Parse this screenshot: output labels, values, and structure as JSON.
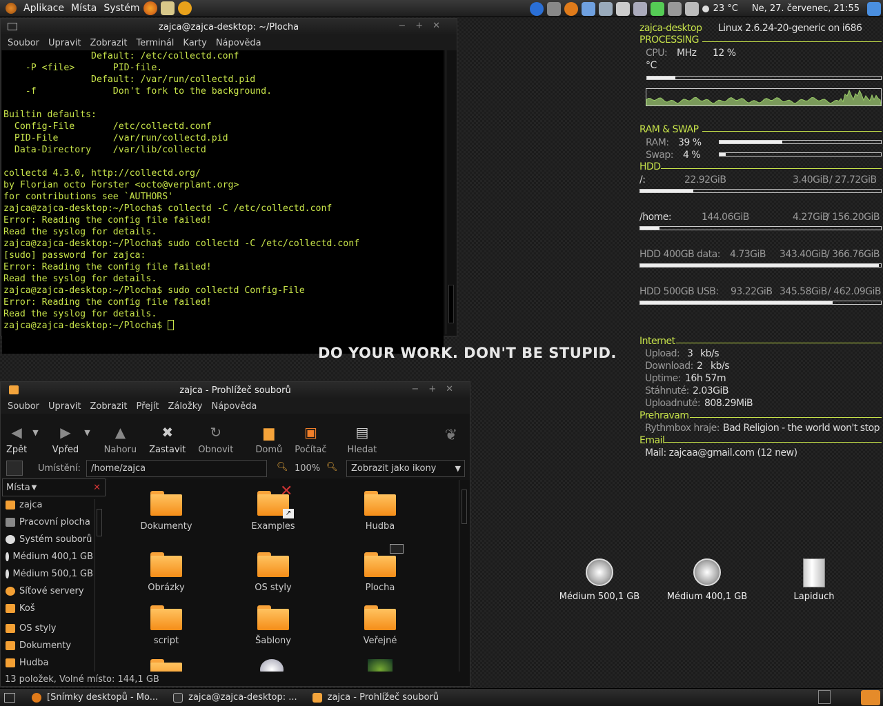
{
  "top_panel": {
    "menu_apps": "Aplikace",
    "menu_places": "Místa",
    "menu_system": "Systém",
    "temp": "23 °C",
    "clock": "Ne, 27. červenec, 21:55"
  },
  "terminal": {
    "title": "zajca@zajca-desktop: ~/Plocha",
    "menu": [
      "Soubor",
      "Upravit",
      "Zobrazit",
      "Terminál",
      "Karty",
      "Nápověda"
    ],
    "lines": [
      "                Default: /etc/collectd.conf",
      "    -P <file>       PID-file.",
      "                Default: /var/run/collectd.pid",
      "    -f              Don't fork to the background.",
      "",
      "Builtin defaults:",
      "  Config-File       /etc/collectd.conf",
      "  PID-File          /var/run/collectd.pid",
      "  Data-Directory    /var/lib/collectd",
      "",
      "collectd 4.3.0, http://collectd.org/",
      "by Florian octo Forster <octo@verplant.org>",
      "for contributions see `AUTHORS'",
      "zajca@zajca-desktop:~/Plocha$ collectd -C /etc/collectd.conf",
      "Error: Reading the config file failed!",
      "Read the syslog for details.",
      "zajca@zajca-desktop:~/Plocha$ sudo collectd -C /etc/collectd.conf",
      "[sudo] password for zajca:",
      "Error: Reading the config file failed!",
      "Read the syslog for details.",
      "zajca@zajca-desktop:~/Plocha$ sudo collectd Config-File",
      "Error: Reading the config file failed!",
      "Read the syslog for details."
    ],
    "prompt": "zajca@zajca-desktop:~/Plocha$ "
  },
  "slogan": "DO YOUR WORK. DON'T BE STUPID.",
  "filemanager": {
    "title": "zajca - Prohlížeč souborů",
    "menu": [
      "Soubor",
      "Upravit",
      "Zobrazit",
      "Přejít",
      "Záložky",
      "Nápověda"
    ],
    "toolbar": {
      "back": "Zpět",
      "forward": "Vpřed",
      "up": "Nahoru",
      "stop": "Zastavit",
      "reload": "Obnovit",
      "home": "Domů",
      "computer": "Počítač",
      "search": "Hledat"
    },
    "location_label": "Umístění:",
    "location": "/home/zajca",
    "zoom": "100%",
    "view_mode": "Zobrazit jako ikony",
    "side_header": "Místa",
    "side_items": [
      "zajca",
      "Pracovní plocha",
      "Systém souborů",
      "Médium 400,1 GB",
      "Médium 500,1 GB",
      "Síťové servery",
      "Koš",
      "OS styly",
      "Dokumenty",
      "Hudba"
    ],
    "icons": [
      "Dokumenty",
      "Examples",
      "Hudba",
      "Obrázky",
      "OS styly",
      "Plocha",
      "script",
      "Šablony",
      "Veřejné"
    ],
    "status": "13 položek, Volné místo: 144,1 GB"
  },
  "conky": {
    "host": "zajca-desktop",
    "kernel": "Linux 2.6.24-20-generic on i686",
    "processing": "PROCESSING",
    "cpu_label": "CPU:",
    "cpu_mhz": "MHz",
    "cpu_pct": "12 %",
    "cpu_temp": "°C",
    "ram_swap": "RAM & SWAP",
    "ram_label": "RAM:",
    "ram_pct": "39 %",
    "swap_label": "Swap:",
    "swap_pct": "4 %",
    "hdd": "HDD",
    "disks": [
      {
        "name": "/:",
        "used": "22.92GiB",
        "free": "3.40GiB",
        "total": "/ 27.72GiB",
        "fill": 0.22
      },
      {
        "name": "/home:",
        "used": "144.06GiB",
        "free": "4.27GiB",
        "total": "/ 156.20GiB",
        "fill": 0.08
      },
      {
        "name": "HDD 400GB data:",
        "used": "4.73GiB",
        "free": "343.40GiB",
        "total": "/ 366.76GiB",
        "fill": 0.99
      },
      {
        "name": "HDD 500GB USB:",
        "used": "93.22GiB",
        "free": "345.58GiB",
        "total": "/ 462.09GiB",
        "fill": 0.8
      }
    ],
    "internet": "Internet",
    "upload_label": "Upload:",
    "upload": "3",
    "download_label": "Download:",
    "download": "2",
    "unit": "kb/s",
    "uptime_label": "Uptime:",
    "uptime": "16h 57m",
    "down_total_label": "Stáhnuté:",
    "down_total": "2.03GiB",
    "up_total_label": "Uploadnuté:",
    "up_total": "808.29MiB",
    "player": "Prehravam",
    "player_label": "Rythmbox hraje:",
    "player_song": "Bad Religion - the world won't stop",
    "email": "Email",
    "mail": "Mail: zajcaa@gmail.com (12 new)",
    "ram_fill": 0.39,
    "swap_fill": 0.04,
    "cpu_fill": 0.12
  },
  "desktop": {
    "icons": [
      "Médium 500,1 GB",
      "Médium 400,1 GB",
      "Lapiduch"
    ]
  },
  "taskbar": [
    "[Snímky desktopů - Mo...",
    "zajca@zajca-desktop: ...",
    "zajca - Prohlížeč souborů"
  ]
}
